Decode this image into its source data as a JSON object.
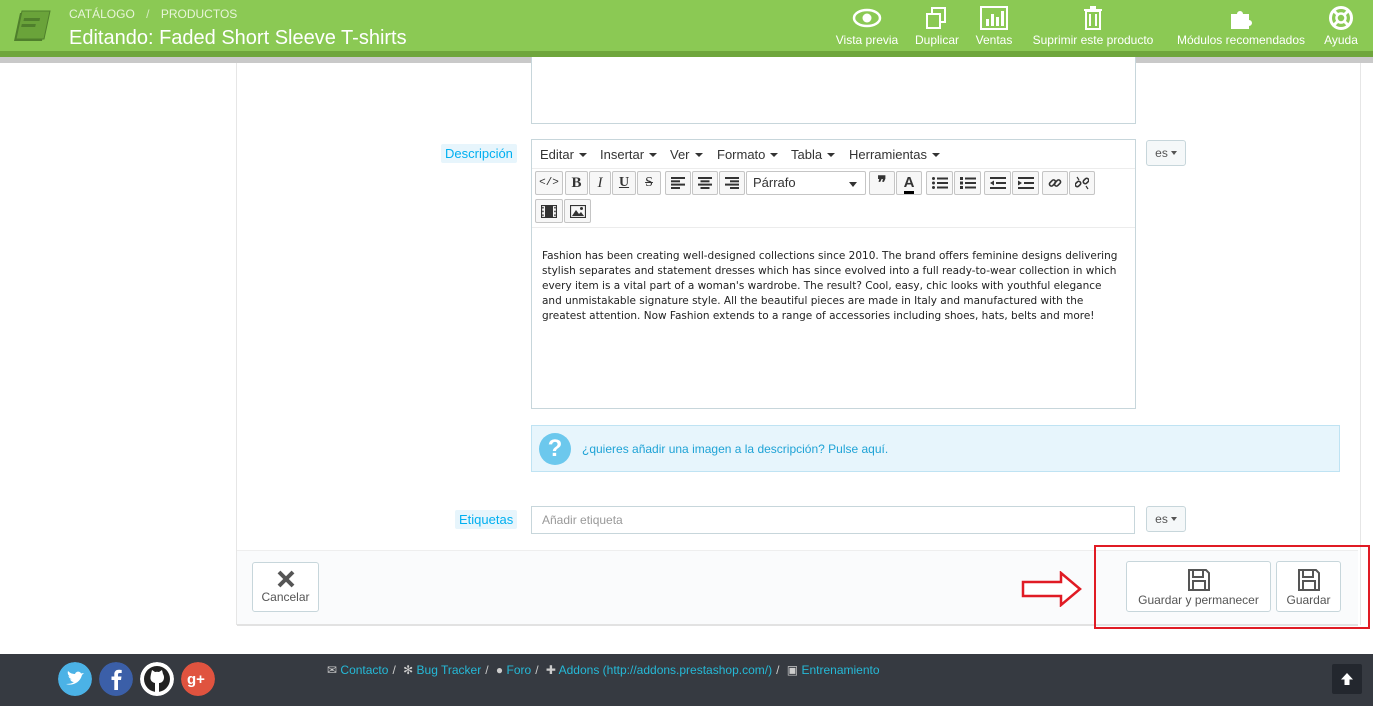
{
  "header": {
    "breadcrumb": [
      "Catálogo",
      "Productos"
    ],
    "title": "Editando: Faded Short Sleeve T-shirts",
    "actions": [
      {
        "label": "Vista previa",
        "icon": "eye-icon"
      },
      {
        "label": "Duplicar",
        "icon": "copy-icon"
      },
      {
        "label": "Ventas",
        "icon": "bar-chart-icon"
      },
      {
        "label": "Suprimir este producto",
        "icon": "trash-icon"
      },
      {
        "label": "Módulos recomendados",
        "icon": "puzzle-icon"
      },
      {
        "label": "Ayuda",
        "icon": "lifebuoy-icon"
      }
    ]
  },
  "description": {
    "label": "Descripción",
    "language": "es",
    "menu": [
      "Editar",
      "Insertar",
      "Ver",
      "Formato",
      "Tabla",
      "Herramientas"
    ],
    "format_select": "Párrafo",
    "text": "Fashion has been creating well-designed collections since 2010. The brand offers feminine designs delivering stylish separates and statement dresses which has since evolved into a full ready-to-wear collection in which every item is a vital part of a woman's wardrobe. The result? Cool, easy, chic looks with youthful elegance and unmistakable signature style. All the beautiful pieces are made in Italy and manufactured with the greatest attention. Now Fashion extends to a range of accessories including shoes, hats, belts and more!",
    "help_text": "¿quieres añadir una imagen a la descripción? Pulse aquí."
  },
  "tags": {
    "label": "Etiquetas",
    "placeholder": "Añadir etiqueta",
    "language": "es"
  },
  "footer": {
    "cancel": "Cancelar",
    "save_stay": "Guardar y permanecer",
    "save": "Guardar"
  },
  "bottom": {
    "links": [
      "Contacto",
      "Bug Tracker",
      "Foro",
      "Addons (http://addons.prestashop.com/)",
      "Entrenamiento"
    ],
    "social": [
      "twitter-icon",
      "facebook-icon",
      "github-icon",
      "google-plus-icon"
    ]
  },
  "colors": {
    "header_green": "#8bc954",
    "link_blue": "#00aff0",
    "highlight_red": "#e01b24",
    "footer_dark": "#363a41"
  }
}
